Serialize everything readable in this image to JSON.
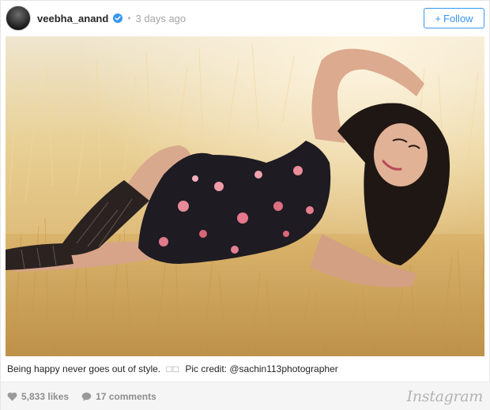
{
  "post": {
    "username": "veebha_anand",
    "separator": "•",
    "time": "3 days ago",
    "follow_label": "Follow",
    "follow_plus": "+",
    "photo_alt": "Woman in a floral dress lying in dry golden grass"
  },
  "caption": {
    "text": "Being happy never goes out of style.",
    "boxes": "□□",
    "credit_prefix": "Pic credit:",
    "mention": "@sachin113photographer"
  },
  "footer": {
    "likes": "5,833 likes",
    "comments": "17 comments",
    "brand": "Instagram"
  },
  "colors": {
    "accent": "#3897f0",
    "footer_bg": "#f5f5f5",
    "muted_text": "#8e8e8e"
  },
  "icons": {
    "verified": "verified-badge-icon",
    "like": "heart-icon",
    "comment": "speech-bubble-icon"
  }
}
